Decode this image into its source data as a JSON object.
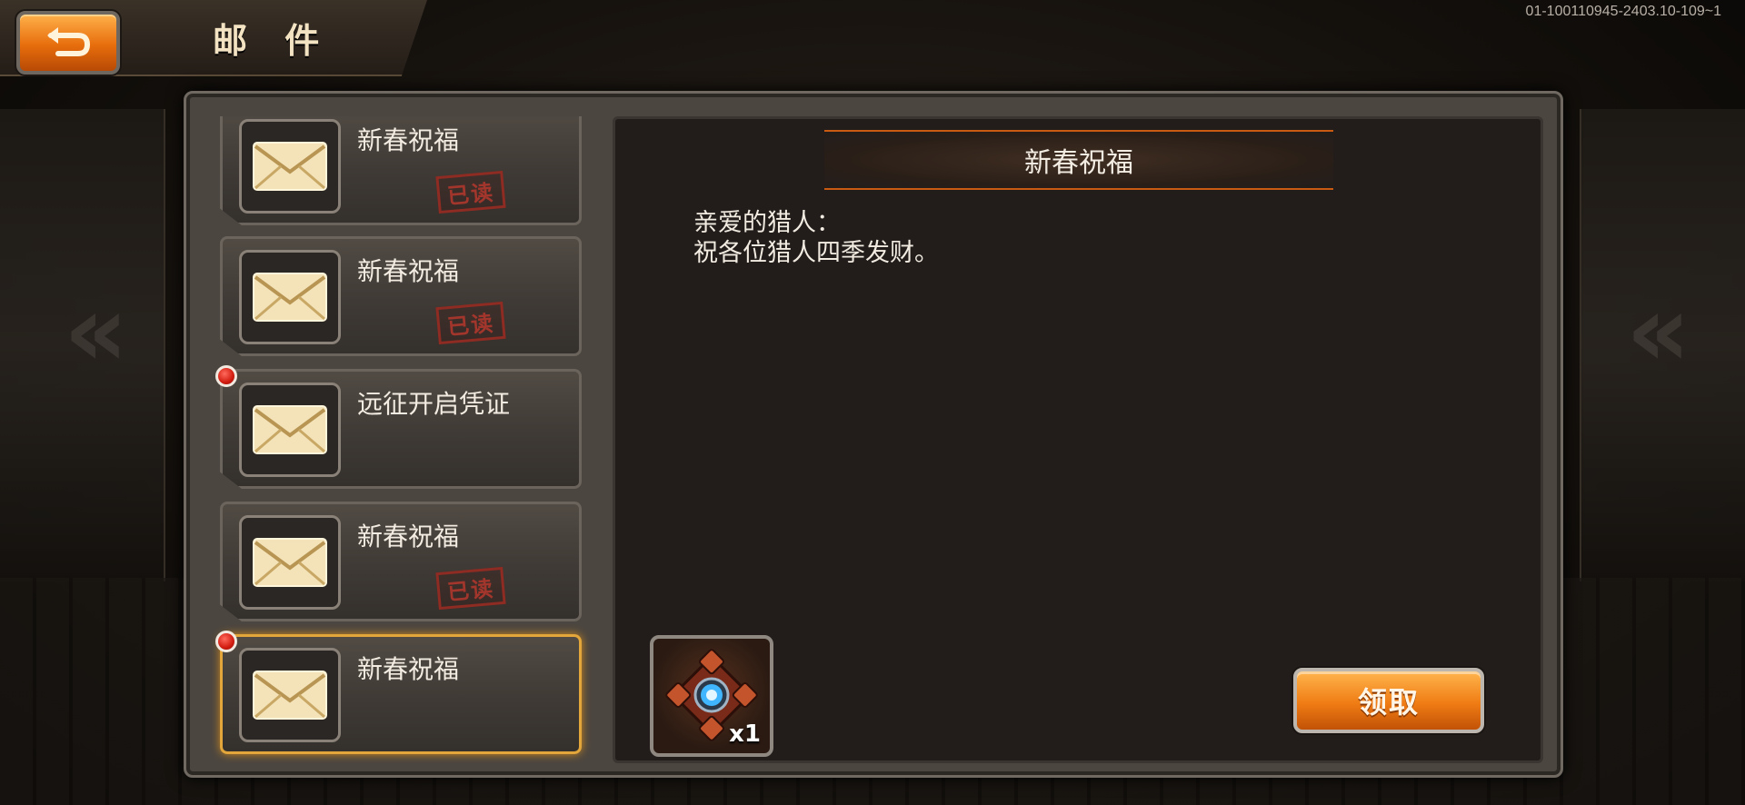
{
  "header": {
    "title": "邮 件",
    "version": "01-100110945-2403.10-109~1"
  },
  "mail_list": [
    {
      "title": "新春祝福",
      "read_stamp": "已读",
      "unread": false,
      "selected": false
    },
    {
      "title": "新春祝福",
      "read_stamp": "已读",
      "unread": false,
      "selected": false
    },
    {
      "title": "远征开启凭证",
      "read_stamp": "",
      "unread": true,
      "selected": false
    },
    {
      "title": "新春祝福",
      "read_stamp": "已读",
      "unread": false,
      "selected": false
    },
    {
      "title": "新春祝福",
      "read_stamp": "",
      "unread": true,
      "selected": true
    }
  ],
  "detail": {
    "title": "新春祝福",
    "greeting": "亲爱的猎人：",
    "body": "祝各位猎人四季发财。",
    "reward": {
      "icon": "crate-icon",
      "count": "x1"
    },
    "claim_label": "领取"
  },
  "colors": {
    "accent": "#f07c14",
    "selected_border": "#e2a63a",
    "read_stamp": "#a3362c",
    "unread_dot": "#d21c10"
  }
}
